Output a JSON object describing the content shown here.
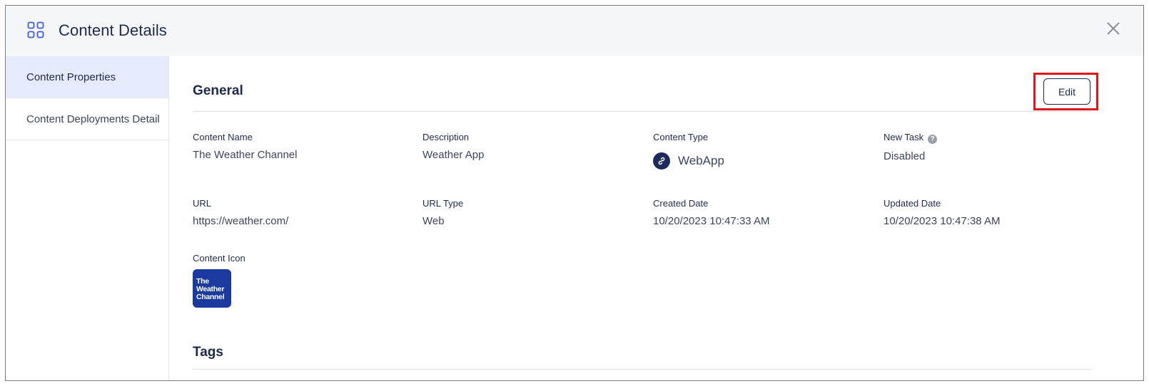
{
  "header": {
    "title": "Content Details",
    "icon": "grid-icon",
    "close_icon": "close-icon"
  },
  "sidebar": {
    "items": [
      {
        "label": "Content Properties",
        "active": true
      },
      {
        "label": "Content Deployments Detail",
        "active": false
      }
    ]
  },
  "general": {
    "title": "General",
    "edit_label": "Edit",
    "fields": {
      "content_name": {
        "label": "Content Name",
        "value": "The Weather Channel"
      },
      "description": {
        "label": "Description",
        "value": "Weather App"
      },
      "content_type": {
        "label": "Content Type",
        "value": "WebApp",
        "icon": "link-icon"
      },
      "new_task": {
        "label": "New Task",
        "value": "Disabled",
        "help_icon": "help-icon"
      },
      "url": {
        "label": "URL",
        "value": "https://weather.com/"
      },
      "url_type": {
        "label": "URL Type",
        "value": "Web"
      },
      "created_date": {
        "label": "Created Date",
        "value": "10/20/2023 10:47:33 AM"
      },
      "updated_date": {
        "label": "Updated Date",
        "value": "10/20/2023 10:47:38 AM"
      },
      "content_icon": {
        "label": "Content Icon",
        "logo_text": "The Weather Channel"
      }
    }
  },
  "tags": {
    "title": "Tags"
  },
  "colors": {
    "accent": "#3b5bdb",
    "text_primary": "#1e2a4d",
    "highlight": "#e0161b",
    "logo_background": "#1a3aa0"
  }
}
